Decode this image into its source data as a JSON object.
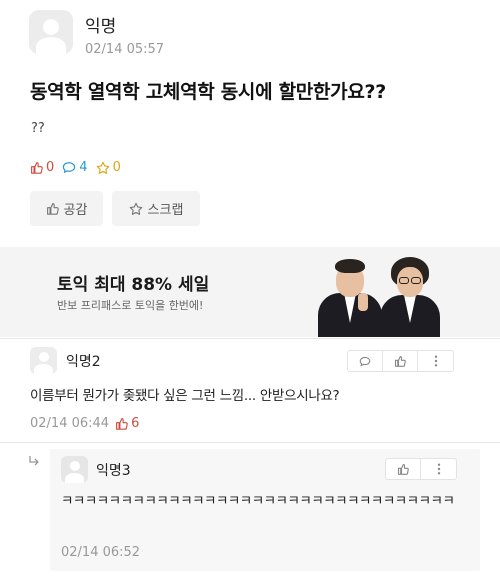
{
  "post": {
    "author": "익명",
    "time": "02/14 05:57",
    "title": "동역학 열역학 고체역학 동시에 할만한가요??",
    "body": "??",
    "stats": {
      "likes": "0",
      "comments": "4",
      "scraps": "0"
    },
    "buttons": {
      "empathy": "공감",
      "scrap": "스크랩"
    }
  },
  "ad": {
    "title": "토익 최대 88% 세일",
    "subtitle": "반보 프리패스로 토익을 한번에!"
  },
  "comments": [
    {
      "author": "익명2",
      "text": "이름부터 뭔가가 좆됐다 싶은 그런 느낌... 안받으시나요?",
      "time": "02/14 06:44",
      "likes": "6"
    }
  ],
  "reply": {
    "author": "익명3",
    "text": "ㅋㅋㅋㅋㅋㅋㅋㅋㅋㅋㅋㅋㅋㅋㅋㅋㅋㅋㅋㅋㅋㅋㅋㅋㅋㅋㅋㅋㅋㅋㅋㅋㅋ",
    "time": "02/14 06:52"
  },
  "colors": {
    "like": "#d04a3e",
    "comment": "#2b9ad0",
    "scrap": "#d9a816",
    "muted": "#999999"
  },
  "icons": [
    "thumbs-up-icon",
    "speech-bubble-icon",
    "star-icon",
    "more-vertical-icon",
    "reply-arrow-icon"
  ]
}
